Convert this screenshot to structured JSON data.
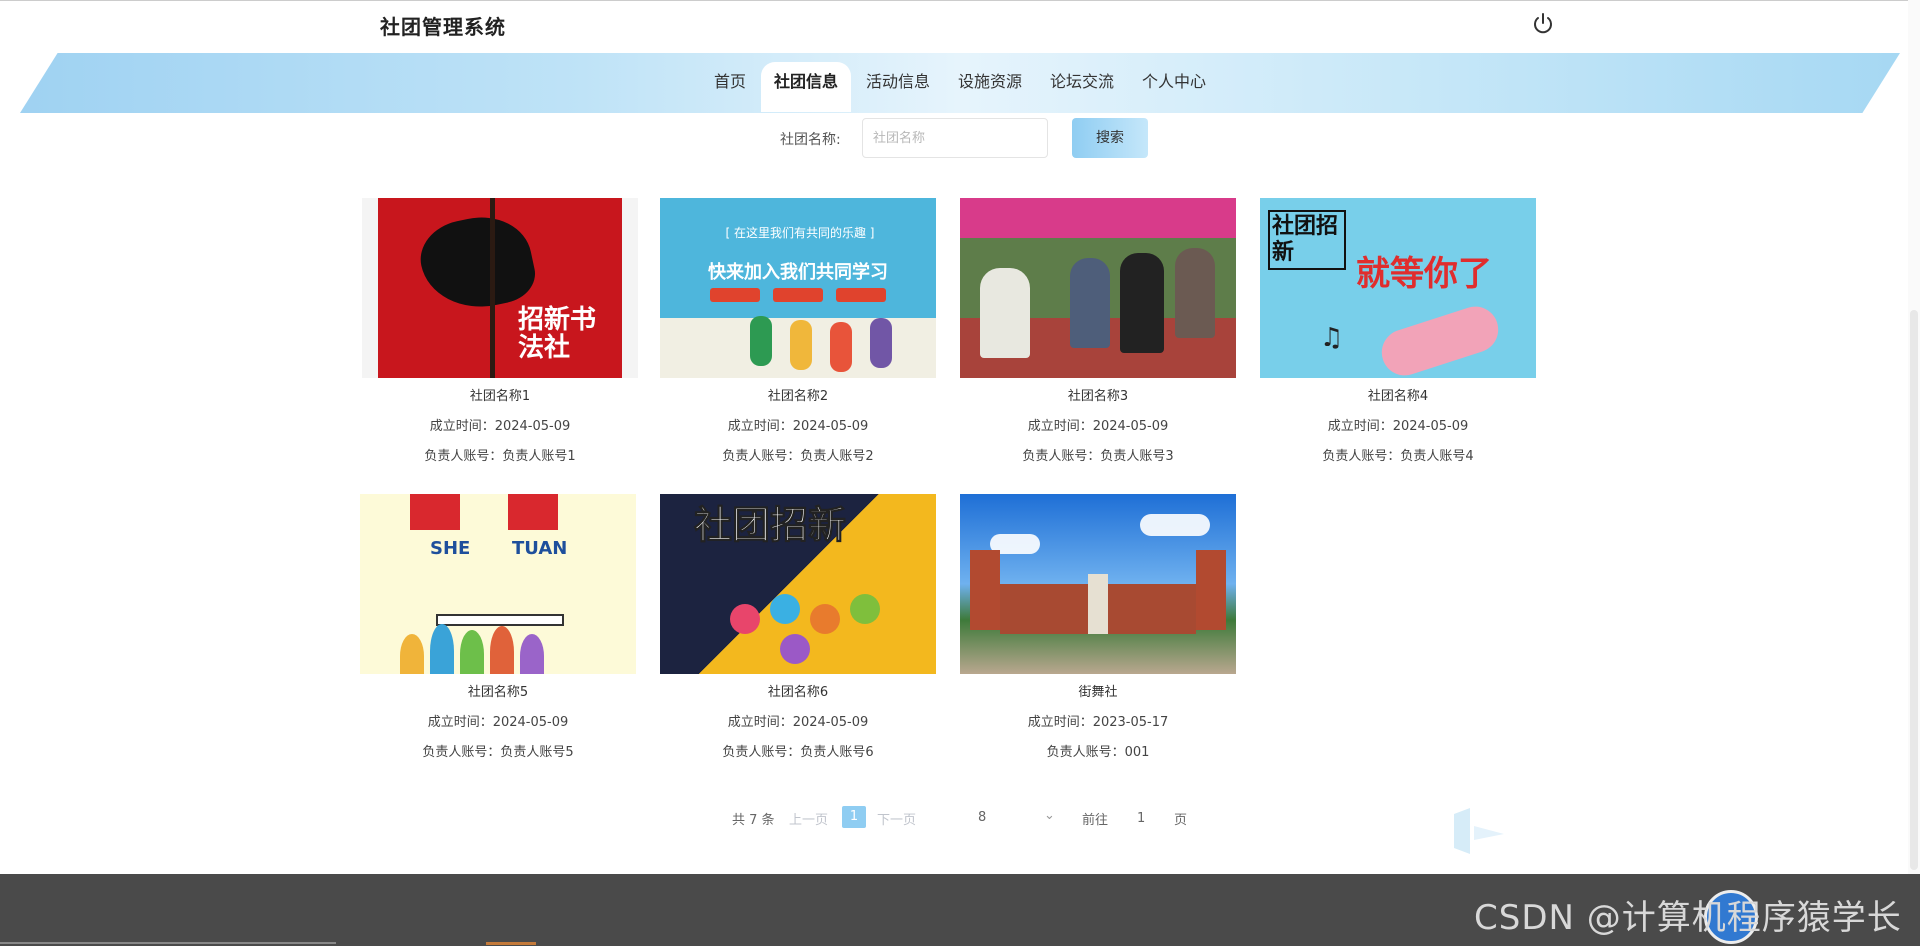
{
  "app": {
    "title": "社团管理系统"
  },
  "nav": {
    "items": [
      {
        "label": "首页",
        "active": false
      },
      {
        "label": "社团信息",
        "active": true
      },
      {
        "label": "活动信息",
        "active": false
      },
      {
        "label": "设施资源",
        "active": false
      },
      {
        "label": "论坛交流",
        "active": false
      },
      {
        "label": "个人中心",
        "active": false
      }
    ]
  },
  "search": {
    "label": "社团名称:",
    "placeholder": "社团名称",
    "button": "搜索"
  },
  "clubs": [
    {
      "name": "社团名称1",
      "date": "成立时间：2024-05-09",
      "owner": "负责人账号：负责人账号1",
      "image": "red calligraphy club poster",
      "imgtext": "招新书法社"
    },
    {
      "name": "社团名称2",
      "date": "成立时间：2024-05-09",
      "owner": "负责人账号：负责人账号2",
      "image": "blue recruitment poster",
      "imgtext": "快来加入我们共同学习",
      "imgtext2": "[ 在这里我们有共同的乐趣 ]"
    },
    {
      "name": "社团名称3",
      "date": "成立时间：2024-05-09",
      "owner": "负责人账号：负责人账号3",
      "image": "students sitting outdoors photo"
    },
    {
      "name": "社团名称4",
      "date": "成立时间：2024-05-09",
      "owner": "负责人账号：负责人账号4",
      "image": "music club recruitment poster",
      "imgtext": "社团招新",
      "imgtext2": "就等你了"
    },
    {
      "name": "社团名称5",
      "date": "成立时间：2024-05-09",
      "owner": "负责人账号：负责人账号5",
      "image": "SHE TUAN poster",
      "imgtext": "SHE",
      "imgtext2": "TUAN"
    },
    {
      "name": "社团名称6",
      "date": "成立时间：2024-05-09",
      "owner": "负责人账号：负责人账号6",
      "image": "yellow navy recruitment poster",
      "imgtext": "社团招新"
    },
    {
      "name": "街舞社",
      "date": "成立时间：2023-05-17",
      "owner": "负责人账号：001",
      "image": "campus building photo"
    }
  ],
  "pager": {
    "total": "共 7 条",
    "prev": "上一页",
    "page": "1",
    "next": "下一页",
    "size": "8",
    "goto": "前往",
    "goto_value": "1",
    "unit": "页"
  },
  "watermark": "CSDN @计算机程序猿学长",
  "colors": {
    "accent": "#8fcdf2",
    "footer": "#4a4a4a"
  }
}
